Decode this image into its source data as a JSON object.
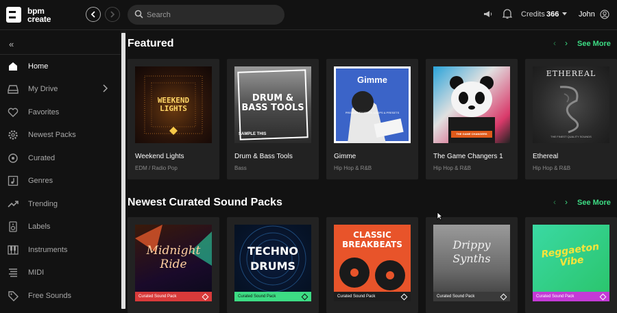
{
  "brand": {
    "line1": "bpm",
    "line2": "create"
  },
  "search": {
    "placeholder": "Search"
  },
  "topbar": {
    "credits_label": "Credits",
    "credits_value": "366",
    "user": "John"
  },
  "sidebar": {
    "items": [
      {
        "label": "Home",
        "icon": "home-icon",
        "active": true
      },
      {
        "label": "My Drive",
        "icon": "drive-icon"
      },
      {
        "label": "Favorites",
        "icon": "heart-icon"
      },
      {
        "label": "Newest Packs",
        "icon": "gear-icon"
      },
      {
        "label": "Curated",
        "icon": "target-icon"
      },
      {
        "label": "Genres",
        "icon": "music-note-icon"
      },
      {
        "label": "Trending",
        "icon": "trending-icon"
      },
      {
        "label": "Labels",
        "icon": "speaker-icon"
      },
      {
        "label": "Instruments",
        "icon": "piano-icon"
      },
      {
        "label": "MIDI",
        "icon": "midi-icon"
      },
      {
        "label": "Free Sounds",
        "icon": "tag-icon"
      }
    ]
  },
  "featured": {
    "title": "Featured",
    "see_more": "See More",
    "cards": [
      {
        "title": "Weekend Lights",
        "genre": "EDM / Radio Pop",
        "art_text": "WEEKEND LIGHTS"
      },
      {
        "title": "Drum & Bass Tools",
        "genre": "Bass",
        "art_text": "DRUM & BASS TOOLS",
        "art_sub": "SAMPLE THIS"
      },
      {
        "title": "Gimme",
        "genre": "Hip Hop & R&B",
        "art_text": "Gimme",
        "art_sub": "PREMIUM SAMPLES, LOOPS & PRESETS"
      },
      {
        "title": "The Game Changers 1",
        "genre": "Hip Hop & R&B",
        "art_text": "THE GAME CHANGERS"
      },
      {
        "title": "Ethereal",
        "genre": "Hip Hop & R&B",
        "art_text": "ETHEREAL",
        "art_sub": "THE FINEST QUALITY SOUNDS"
      }
    ]
  },
  "newest": {
    "title": "Newest Curated Sound Packs",
    "see_more": "See More",
    "cards": [
      {
        "band": "Curated Sound Pack",
        "art_text": "Midnight Ride",
        "color": "#d83a3a"
      },
      {
        "band": "Curated Sound Pack",
        "art_text": "TECHNO DRUMS",
        "color": "#3ddc84"
      },
      {
        "band": "Curated Sound Pack",
        "art_text": "CLASSIC BREAKBEATS",
        "color": "#1e1e1e"
      },
      {
        "band": "Curated Sound Pack",
        "art_text": "Drippy Synths",
        "color": "#3a3a3a"
      },
      {
        "band": "Curated Sound Pack",
        "art_text": "Reggaeton Vibe",
        "color": "#c43ad6"
      }
    ]
  }
}
